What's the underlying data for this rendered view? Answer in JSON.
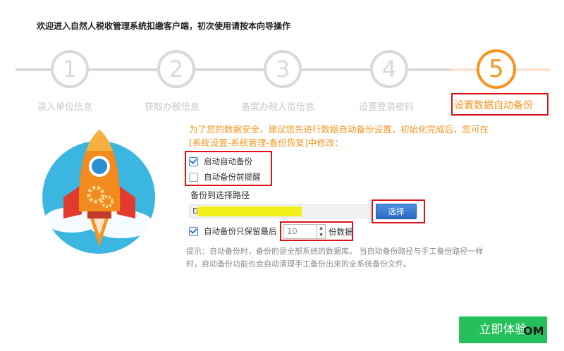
{
  "title": "欢迎进入自然人税收管理系统扣缴客户端，初次使用请按本向导操作",
  "steps": [
    {
      "number": "1",
      "label": "录入单位信息",
      "state": "done"
    },
    {
      "number": "2",
      "label": "获取办税信息",
      "state": "done"
    },
    {
      "number": "3",
      "label": "备案办税人员信息",
      "state": "done"
    },
    {
      "number": "4",
      "label": "设置登录密码",
      "state": "done"
    },
    {
      "number": "5",
      "label": "设置数据自动备份",
      "state": "active"
    }
  ],
  "notice": "为了您的数据安全，建议您先进行数据自动备份设置，初始化完成后，您可在[系统设置-系统管理-备份恢复]中修改：",
  "options": {
    "auto_backup": {
      "label": "启动自动备份",
      "checked": true
    },
    "remind_before": {
      "label": "自动备份前提醒",
      "checked": false
    }
  },
  "backup_path": {
    "label": "备份到选择路径",
    "value": "D",
    "choose_label": "选择"
  },
  "keep": {
    "label": "自动备份只保留最后",
    "checked": true,
    "value": "10",
    "unit_label": "份数据"
  },
  "hint": "提示：自动备份时，备份的是全部系统的数据库。 当自动备份路径与手工备份路径一样时，自动备份功能也会自动清理手工备份出来的全系统备份文件。",
  "start_button": "立即体验",
  "watermark": "OM",
  "colors": {
    "accent": "#f7941d",
    "highlight": "#d9121b",
    "primary_button": "#25c05b",
    "step_inactive": "#d9d9d9"
  }
}
